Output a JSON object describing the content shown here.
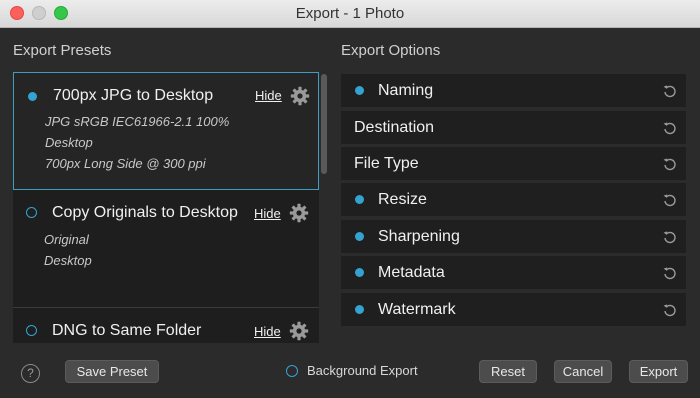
{
  "window": {
    "title": "Export - 1 Photo"
  },
  "presets_panel": {
    "title": "Export Presets",
    "hide_label": "Hide",
    "items": [
      {
        "name": "700px JPG to Desktop",
        "selected": true,
        "details": [
          "JPG  sRGB IEC61966-2.1  100%",
          "Desktop",
          "700px Long Side @ 300 ppi"
        ]
      },
      {
        "name": "Copy Originals to Desktop",
        "selected": false,
        "details": [
          "Original",
          "Desktop"
        ]
      },
      {
        "name": "DNG to Same Folder",
        "selected": false,
        "details": []
      }
    ]
  },
  "options_panel": {
    "title": "Export Options",
    "items": [
      {
        "label": "Naming",
        "enabled": true
      },
      {
        "label": "Destination",
        "enabled": false
      },
      {
        "label": "File Type",
        "enabled": false
      },
      {
        "label": "Resize",
        "enabled": true
      },
      {
        "label": "Sharpening",
        "enabled": true
      },
      {
        "label": "Metadata",
        "enabled": true
      },
      {
        "label": "Watermark",
        "enabled": true
      }
    ]
  },
  "footer": {
    "help_label": "?",
    "save_preset_label": "Save Preset",
    "background_export_label": "Background Export",
    "reset_label": "Reset",
    "cancel_label": "Cancel",
    "export_label": "Export"
  },
  "colors": {
    "accent": "#34a3d1",
    "panel": "#1e1e1e",
    "background": "#2b2b2b"
  },
  "icons": {
    "gear": "gear-icon",
    "reset": "reset-icon",
    "help": "help-icon"
  }
}
